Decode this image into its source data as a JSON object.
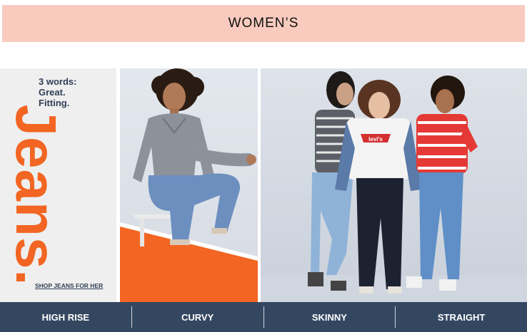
{
  "header": {
    "title": "WOMEN’S"
  },
  "banner": {
    "tagline": "3 words:\nGreat.\nFitting.",
    "headline": "Jeans.",
    "cta": "SHOP JEANS FOR HER",
    "colors": {
      "accent": "#f26522",
      "navy": "#2f3e55",
      "header_bg": "#f9cbbf"
    }
  },
  "nav": {
    "items": [
      {
        "label": "HIGH RISE"
      },
      {
        "label": "CURVY"
      },
      {
        "label": "SKINNY"
      },
      {
        "label": "STRAIGHT"
      }
    ]
  },
  "shirt_logo": "levi's"
}
